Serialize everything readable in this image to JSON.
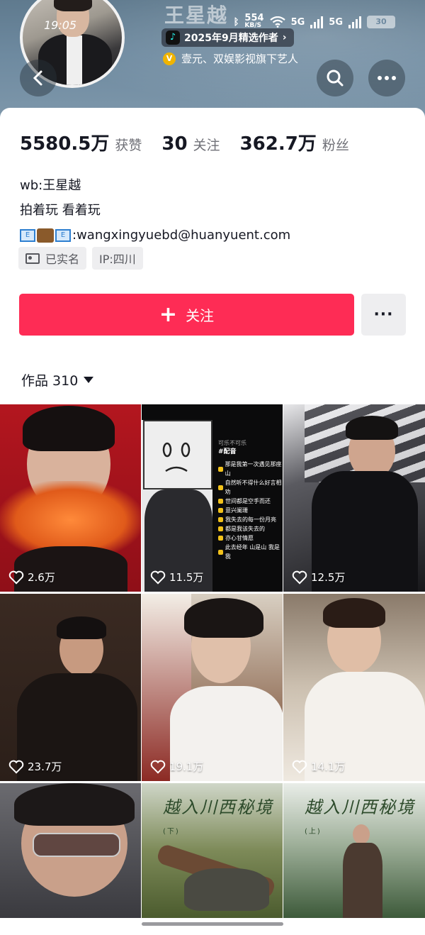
{
  "status_bar": {
    "time": "19:05",
    "speed": "554",
    "speed_unit": "KB/S",
    "net1": "5G",
    "net2": "5G",
    "battery": "30"
  },
  "profile": {
    "name": "王星越",
    "selected_pill": "2025年9月精选作者",
    "agency": "壹元、双娱影视旗下艺人",
    "stats": [
      {
        "value": "5580.5万",
        "label": "获赞"
      },
      {
        "value": "30",
        "label": "关注"
      },
      {
        "value": "362.7万",
        "label": "粉丝"
      }
    ],
    "bio": [
      "wb:王星越",
      "拍着玩 看着玩"
    ],
    "email": ":wangxingyuebd@huanyuent.com",
    "tags": [
      {
        "label": "已实名",
        "icon": "id-card-icon"
      },
      {
        "label": "IP:四川"
      }
    ]
  },
  "actions": {
    "follow": "关注",
    "more": "···"
  },
  "works": {
    "label": "作品 310"
  },
  "videos": [
    {
      "likes": "2.6万"
    },
    {
      "likes": "11.5万"
    },
    {
      "likes": "12.5万"
    },
    {
      "likes": "23.7万"
    },
    {
      "likes": "19.1万"
    },
    {
      "likes": "14.1万"
    },
    {
      "likes": ""
    },
    {
      "likes": ""
    },
    {
      "likes": ""
    }
  ],
  "lyric_panel": {
    "back": "可乐不可乐",
    "title": "#配音",
    "lines": [
      "那是我第一次遇见那座山",
      "自然听不得什么好言相劝",
      "世间都是空手而还",
      "意兴阑珊",
      "我失去的每一份月亮",
      "都是我该失去的",
      "亦心甘情愿",
      "此去经年 山是山 我是我"
    ]
  },
  "calligraphy": {
    "left": "越入川西秘境",
    "left_mark": "(下)",
    "right": "越入川西秘境",
    "right_mark": "(上)"
  },
  "colors": {
    "accent": "#fe2c55",
    "banner": "#6e8aa0"
  }
}
